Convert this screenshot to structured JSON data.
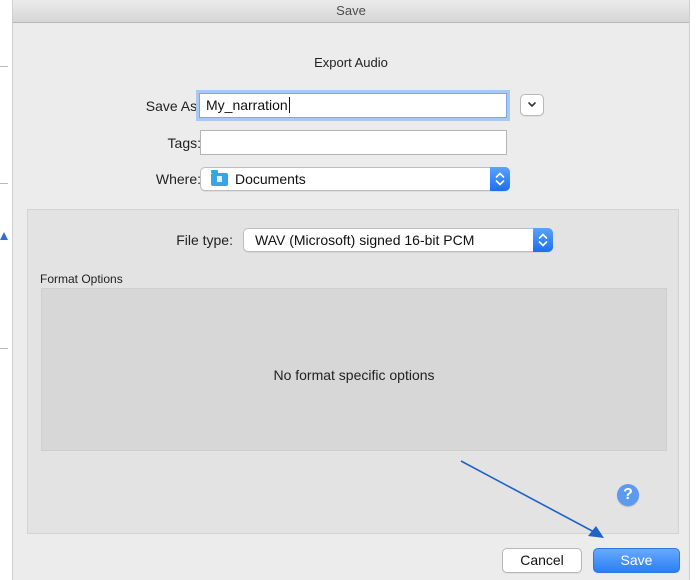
{
  "window": {
    "title": "Save"
  },
  "dialog": {
    "subtitle": "Export Audio"
  },
  "save_as": {
    "label": "Save As:",
    "value": "My_narration"
  },
  "tags": {
    "label": "Tags:",
    "value": ""
  },
  "where": {
    "label": "Where:",
    "value": "Documents"
  },
  "file_type": {
    "label": "File type:",
    "value": "WAV (Microsoft) signed 16-bit PCM"
  },
  "format_options": {
    "label": "Format Options",
    "message": "No format specific options"
  },
  "help": {
    "glyph": "?"
  },
  "buttons": {
    "cancel": "Cancel",
    "save": "Save"
  },
  "colors": {
    "accent": "#2a7ff2",
    "annotation_arrow": "#1f63c7"
  },
  "icons": {
    "folder": "folder-icon",
    "expand": "chevron-down-icon",
    "stepper": "up-down-stepper-icon",
    "help": "help-icon"
  }
}
